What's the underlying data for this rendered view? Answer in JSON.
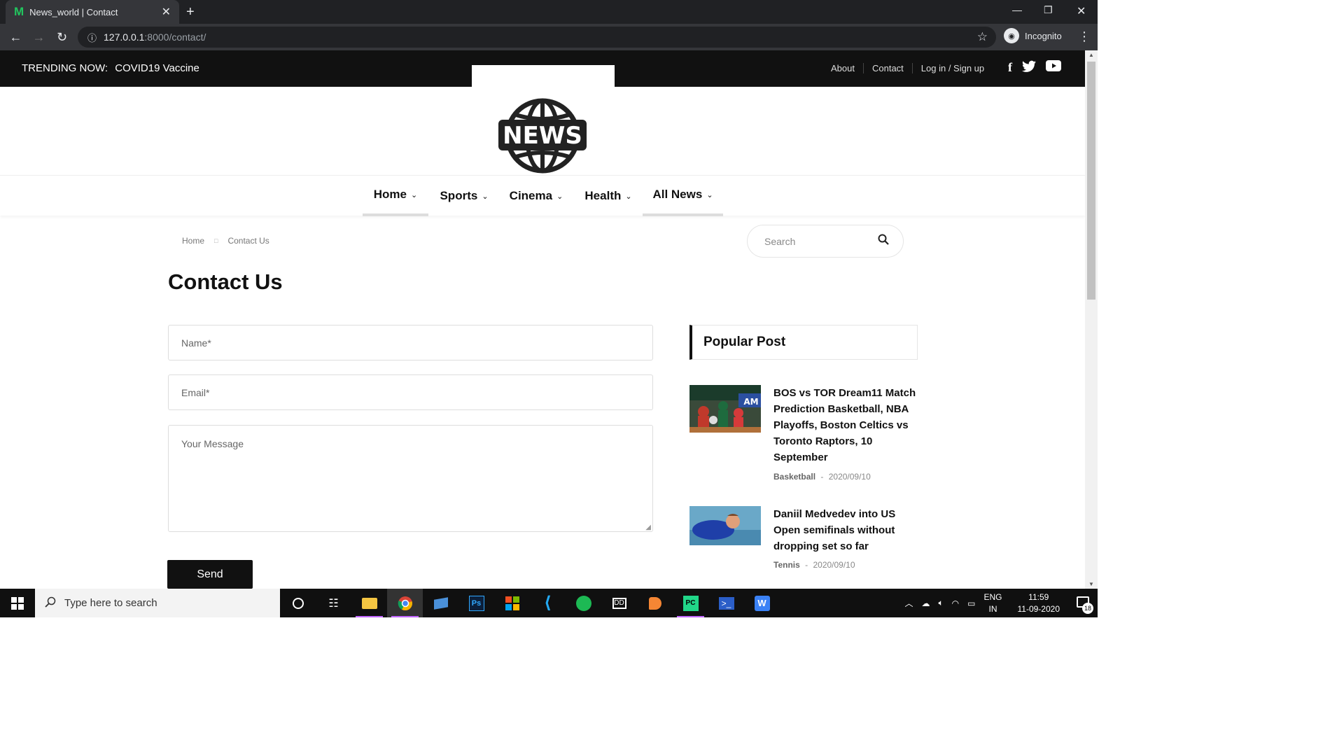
{
  "browser": {
    "tab_title": "News_world | Contact",
    "tab_favicon": "M",
    "url_host": "127.0.0.1",
    "url_rest": ":8000/contact/",
    "profile_label": "Incognito"
  },
  "topbar": {
    "trending_label": "TRENDING NOW:",
    "trending_value": "COVID19 Vaccine",
    "links": [
      "About",
      "Contact",
      "Log in / Sign up"
    ],
    "social_icons": [
      "facebook-icon",
      "twitter-icon",
      "youtube-icon"
    ]
  },
  "logo": {
    "text": "NEWS"
  },
  "mainnav": {
    "items": [
      {
        "label": "Home",
        "active": true
      },
      {
        "label": "Sports",
        "active": false
      },
      {
        "label": "Cinema",
        "active": false
      },
      {
        "label": "Health",
        "active": false
      },
      {
        "label": "All News",
        "active": true
      }
    ]
  },
  "breadcrumb": {
    "home": "Home",
    "current": "Contact Us"
  },
  "search": {
    "placeholder": "Search"
  },
  "page_title": "Contact Us",
  "form": {
    "name_placeholder": "Name*",
    "email_placeholder": "Email*",
    "message_placeholder": "Your Message",
    "send_label": "Send"
  },
  "sidebar": {
    "heading": "Popular Post",
    "posts": [
      {
        "title": "BOS vs TOR Dream11 Match Prediction Basketball, NBA Playoffs, Boston Celtics vs Toronto Raptors, 10 September",
        "category": "Basketball",
        "date": "2020/09/10"
      },
      {
        "title": "Daniil Medvedev into US Open semifinals without dropping set so far",
        "category": "Tennis",
        "date": "2020/09/10"
      }
    ]
  },
  "taskbar": {
    "search_placeholder": "Type here to search",
    "lang_top": "ENG",
    "lang_bottom": "IN",
    "time": "11:59",
    "date": "11-09-2020",
    "notification_count": "18"
  }
}
